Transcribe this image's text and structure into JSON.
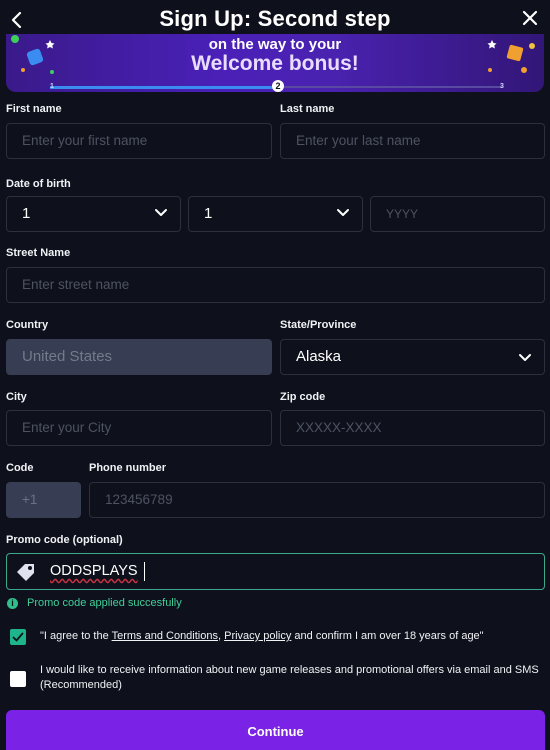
{
  "header": {
    "title": "Sign Up: Second step",
    "back_icon": "chevron-left-icon",
    "close_icon": "close-icon"
  },
  "banner": {
    "line1": "on the way to your",
    "line2": "Welcome bonus!",
    "steps": [
      "1",
      "2",
      "3"
    ],
    "current_step": 2,
    "progress": 0.5
  },
  "form": {
    "first_name": {
      "label": "First name",
      "placeholder": "Enter your first name"
    },
    "last_name": {
      "label": "Last name",
      "placeholder": "Enter your last name"
    },
    "dob": {
      "label": "Date of birth",
      "day": "1",
      "month": "1",
      "year_placeholder": "YYYY"
    },
    "street": {
      "label": "Street Name",
      "placeholder": "Enter street name"
    },
    "country": {
      "label": "Country",
      "value": "United States"
    },
    "state": {
      "label": "State/Province",
      "value": "Alaska"
    },
    "city": {
      "label": "City",
      "placeholder": "Enter your City"
    },
    "zip": {
      "label": "Zip code",
      "placeholder": "XXXXX-XXXX"
    },
    "code": {
      "label": "Code",
      "value": "+1"
    },
    "phone": {
      "label": "Phone number",
      "placeholder": "123456789"
    },
    "promo": {
      "label": "Promo code (optional)",
      "value": "ODDSPLAYS",
      "status": "Promo code applied succesfully"
    }
  },
  "consent": {
    "terms": {
      "checked": true,
      "prefix": "\"I agree to the ",
      "terms_link": "Terms and Conditions",
      "sep": ", ",
      "privacy_link": "Privacy policy",
      "suffix": " and confirm I am over 18 years of age\""
    },
    "marketing": {
      "checked": false,
      "text": "I would like to receive information about new game releases and promotional offers via email and SMS (Recommended)"
    }
  },
  "continue_label": "Continue",
  "colors": {
    "background": "#0e111b",
    "accent": "#7a22e6",
    "success": "#3fcf9a",
    "field_border": "#2b303c"
  }
}
